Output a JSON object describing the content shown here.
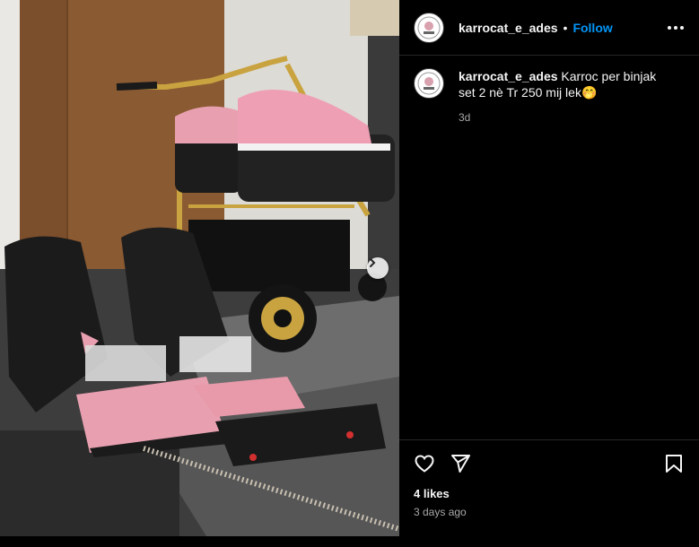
{
  "post": {
    "username": "karrocat_e_ades",
    "separator": "•",
    "follow_label": "Follow",
    "caption_text": "Karroc per binjak set 2 nè Tr 250 mij lek🤭",
    "caption_age": "3d",
    "likes": "4 likes",
    "posted": "3 days ago"
  },
  "icons": {
    "avatar": "profile-logo-icon",
    "more": "more-options-icon",
    "like": "heart-icon",
    "share": "send-icon",
    "save": "bookmark-icon",
    "next": "chevron-right-icon"
  },
  "colors": {
    "follow": "#0095f6",
    "panel_bg": "#000000",
    "secondary_text": "#a8a8a8",
    "stroller_pink": "#e8a0b0",
    "frame_gold": "#c9a340"
  }
}
